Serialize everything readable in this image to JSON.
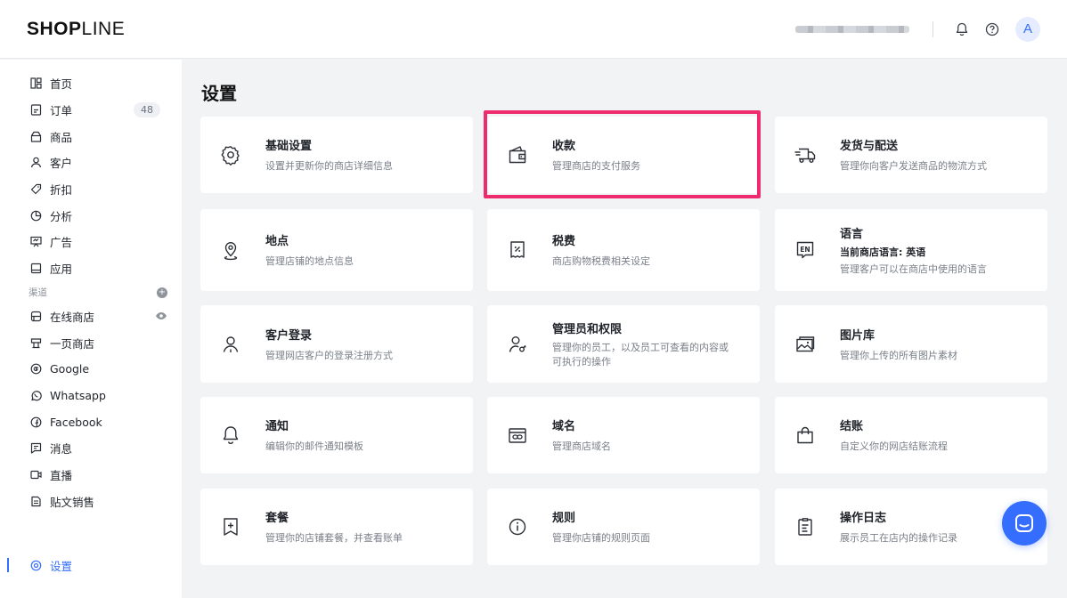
{
  "topbar": {
    "logo_bold": "SHOP",
    "logo_light": "LINE",
    "avatar_letter": "A"
  },
  "sidebar": {
    "items": [
      {
        "label": "首页",
        "icon": "home-icon"
      },
      {
        "label": "订单",
        "icon": "order-icon",
        "badge": "48"
      },
      {
        "label": "商品",
        "icon": "product-icon"
      },
      {
        "label": "客户",
        "icon": "customer-icon"
      },
      {
        "label": "折扣",
        "icon": "discount-icon"
      },
      {
        "label": "分析",
        "icon": "analytics-icon"
      },
      {
        "label": "广告",
        "icon": "ads-icon"
      },
      {
        "label": "应用",
        "icon": "apps-icon"
      }
    ],
    "channels_label": "渠道",
    "channels": [
      {
        "label": "在线商店",
        "icon": "online-store-icon"
      },
      {
        "label": "一页商店",
        "icon": "one-page-store-icon"
      },
      {
        "label": "Google",
        "icon": "google-icon"
      },
      {
        "label": "Whatsapp",
        "icon": "whatsapp-icon"
      },
      {
        "label": "Facebook",
        "icon": "facebook-icon"
      },
      {
        "label": "消息",
        "icon": "message-icon"
      },
      {
        "label": "直播",
        "icon": "live-icon"
      },
      {
        "label": "贴文销售",
        "icon": "post-sales-icon"
      }
    ],
    "settings_label": "设置"
  },
  "main": {
    "title": "设置",
    "cards": [
      {
        "title": "基础设置",
        "desc": "设置并更新你的商店详细信息",
        "icon": "gear-icon"
      },
      {
        "title": "收款",
        "desc": "管理商店的支付服务",
        "icon": "wallet-icon"
      },
      {
        "title": "发货与配送",
        "desc": "管理你向客户发送商品的物流方式",
        "icon": "truck-icon"
      },
      {
        "title": "地点",
        "desc": "管理店铺的地点信息",
        "icon": "location-icon"
      },
      {
        "title": "税费",
        "desc": "商店购物税费相关设定",
        "icon": "tax-receipt-icon"
      },
      {
        "title": "语言",
        "sub": "当前商店语言: 英语",
        "desc": "管理客户可以在商店中使用的语言",
        "icon": "language-icon"
      },
      {
        "title": "客户登录",
        "desc": "管理网店客户的登录注册方式",
        "icon": "customer-login-icon"
      },
      {
        "title": "管理员和权限",
        "desc1": "管理你的员工，以及员工可查看的内容或",
        "desc2": "可执行的操作",
        "icon": "staff-permission-icon"
      },
      {
        "title": "图片库",
        "desc": "管理你上传的所有图片素材",
        "icon": "image-gallery-icon"
      },
      {
        "title": "通知",
        "desc": "编辑你的邮件通知模板",
        "icon": "bell-icon"
      },
      {
        "title": "域名",
        "desc": "管理商店域名",
        "icon": "domain-icon"
      },
      {
        "title": "结账",
        "desc": "自定义你的网店结账流程",
        "icon": "shopping-bag-icon"
      },
      {
        "title": "套餐",
        "desc": "管理你的店铺套餐，并查看账单",
        "icon": "plan-icon"
      },
      {
        "title": "规则",
        "desc": "管理你店铺的规则页面",
        "icon": "info-icon"
      },
      {
        "title": "操作日志",
        "desc": "展示员工在店内的操作记录",
        "icon": "log-icon"
      }
    ]
  },
  "colors": {
    "accent": "#356dff",
    "highlight": "#ee2b6c"
  }
}
